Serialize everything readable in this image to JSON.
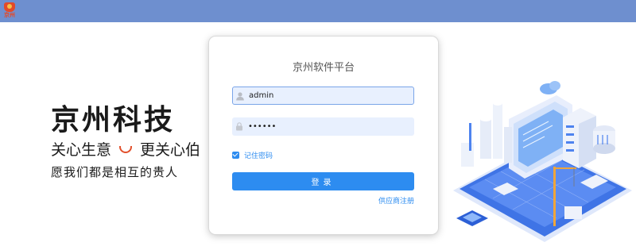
{
  "header": {
    "logo_text": "京州",
    "logo_icon": "company-logo",
    "bar_color": "#6e8fcf"
  },
  "hero": {
    "brand": "京州科技",
    "slogan_left": "关心生意",
    "slogan_right": "更关心伯",
    "motto": "愿我们都是相互的贵人"
  },
  "login": {
    "title": "京州软件平台",
    "username": {
      "value": "admin",
      "icon": "user-icon"
    },
    "password": {
      "value": "••••••",
      "icon": "lock-icon"
    },
    "remember_label": "记住密码",
    "remember_checked": true,
    "submit_label": "登录",
    "supplier_link": "供应商注册"
  },
  "colors": {
    "accent": "#2d8cf0",
    "field_bg": "#e8f0fe"
  }
}
